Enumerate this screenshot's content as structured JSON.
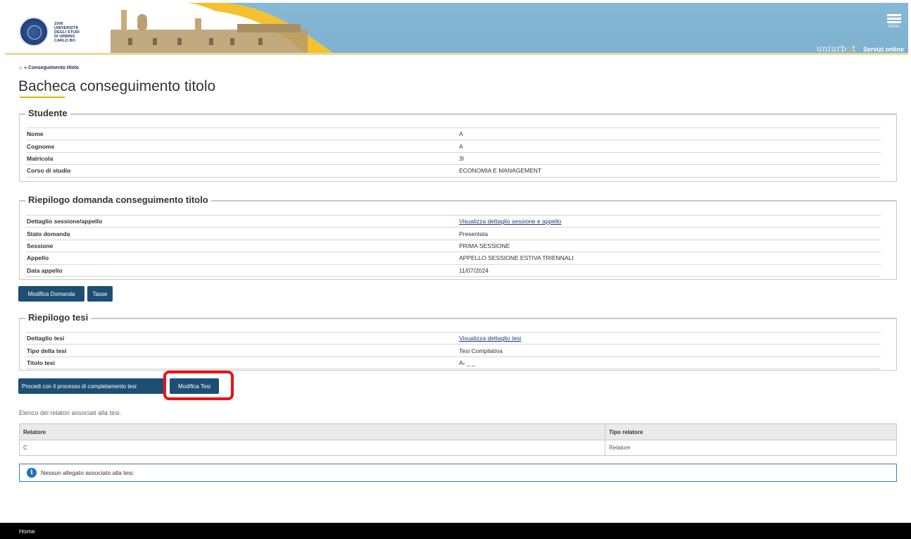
{
  "header": {
    "logo_lines": [
      "1506",
      "UNIVERSITÀ",
      "DEGLI STUDI",
      "DI URBINO",
      "CARLO BO"
    ],
    "menu_label": "MENU",
    "brand_prefix": "uniurb",
    "brand_dot": "o",
    "brand_suffix": "t",
    "servizi": "Servizi online"
  },
  "breadcrumb": {
    "home_icon": "home-icon",
    "separator": "»",
    "current": "Conseguimento titolo"
  },
  "page_title": "Bacheca conseguimento titolo",
  "studente": {
    "legend": "Studente",
    "rows": [
      {
        "label": "Nome",
        "value": "A"
      },
      {
        "label": "Cognome",
        "value": "A"
      },
      {
        "label": "Matricola",
        "value": "3I"
      },
      {
        "label": "Corso di studio",
        "value": "ECONOMIA E MANAGEMENT"
      }
    ]
  },
  "riepilogo_domanda": {
    "legend": "Riepilogo domanda conseguimento titolo",
    "rows": [
      {
        "label": "Dettaglio sessione/appello",
        "value": "Visualizza dettaglio sessione e appello"
      },
      {
        "label": "Stato domanda",
        "value": "Presentata"
      },
      {
        "label": "Sessione",
        "value": "PRIMA SESSIONE"
      },
      {
        "label": "Appello",
        "value": "APPELLO SESSIONE ESTIVA TRIENNALI"
      },
      {
        "label": "Data appello",
        "value": "11/07/2024"
      }
    ]
  },
  "buttons_domanda": {
    "modifica": "Modifica Domanda",
    "tasse": "Tasse"
  },
  "riepilogo_tesi": {
    "legend": "Riepilogo tesi",
    "rows": [
      {
        "label": "Dettaglio tesi",
        "value": "Visualizza dettaglio tesi"
      },
      {
        "label": "Tipo della tesi",
        "value": "Tesi Compilativa"
      },
      {
        "label": "Titolo tesi",
        "value": "A‹ _ _"
      }
    ]
  },
  "buttons_tesi": {
    "procedi": "Procedi con il processo di completamento tesi",
    "modifica": "Modifica Tesi"
  },
  "relatori": {
    "intro": "Elenco dei relatori associati alla tesi.",
    "headers": [
      "Relatore",
      "Tipo relatore"
    ],
    "rows": [
      [
        "C",
        "Relatore"
      ]
    ]
  },
  "info_message": "Nessun allegato associato alla tesi.",
  "footer": {
    "home": "Home"
  },
  "colors": {
    "primary": "#1d4f75",
    "highlight": "#e8141a",
    "accent": "#e0b800",
    "header_bg": "#86b9d6"
  }
}
